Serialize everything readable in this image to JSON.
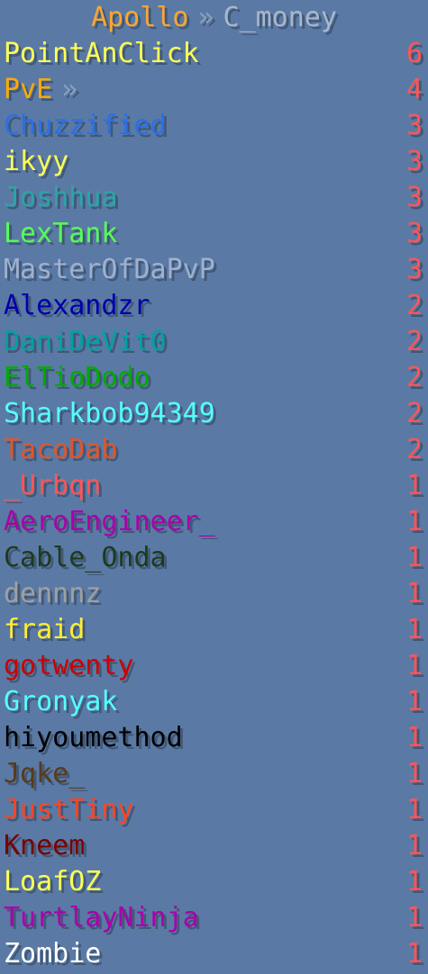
{
  "scoreboard": {
    "header": {
      "server": "Apollo",
      "separator": "»",
      "objective": "C_money"
    },
    "colors": {
      "background": "#5a7aa5",
      "header_server": "#ffa62e",
      "header_separator": "#8aa0c0",
      "header_objective": "#a9b7cc",
      "score": "#ff5555"
    },
    "entries": [
      {
        "name": "PointAnClick",
        "suffix": "",
        "score": "6",
        "color": "#ffff55"
      },
      {
        "name": "PvE",
        "suffix": "»",
        "score": "4",
        "color": "#ffaa00"
      },
      {
        "name": "Chuzzified",
        "suffix": "",
        "score": "3",
        "color": "#2c6fe6"
      },
      {
        "name": "ikyy",
        "suffix": "",
        "score": "3",
        "color": "#ffff55"
      },
      {
        "name": "Joshhua",
        "suffix": "",
        "score": "3",
        "color": "#2aa5a5"
      },
      {
        "name": "LexTank",
        "suffix": "",
        "score": "3",
        "color": "#55ff55"
      },
      {
        "name": "MasterOfDaPvP",
        "suffix": "",
        "score": "3",
        "color": "#9fb1d0"
      },
      {
        "name": "Alexandzr",
        "suffix": "",
        "score": "2",
        "color": "#0000aa"
      },
      {
        "name": "DaniDeVit0",
        "suffix": "",
        "score": "2",
        "color": "#00a0a0"
      },
      {
        "name": "ElTioDodo",
        "suffix": "",
        "score": "2",
        "color": "#00aa00"
      },
      {
        "name": "Sharkbob94349",
        "suffix": "",
        "score": "2",
        "color": "#55ffff"
      },
      {
        "name": "TacoDab",
        "suffix": "",
        "score": "2",
        "color": "#e0552a"
      },
      {
        "name": "_Urbqn",
        "suffix": "",
        "score": "1",
        "color": "#ff5555"
      },
      {
        "name": "AeroEngineer_",
        "suffix": "",
        "score": "1",
        "color": "#aa00aa"
      },
      {
        "name": "Cable_Onda",
        "suffix": "",
        "score": "1",
        "color": "#1e3a1e"
      },
      {
        "name": "dennnz",
        "suffix": "",
        "score": "1",
        "color": "#a0a0a0"
      },
      {
        "name": "fraid",
        "suffix": "",
        "score": "1",
        "color": "#ffee33"
      },
      {
        "name": "gotwenty",
        "suffix": "",
        "score": "1",
        "color": "#cc0000"
      },
      {
        "name": "Gronyak",
        "suffix": "",
        "score": "1",
        "color": "#55ffff"
      },
      {
        "name": "hiyoumethod",
        "suffix": "",
        "score": "1",
        "color": "#000000"
      },
      {
        "name": "Jqke_",
        "suffix": "",
        "score": "1",
        "color": "#5a3a1a"
      },
      {
        "name": "JustTiny",
        "suffix": "",
        "score": "1",
        "color": "#ff4422"
      },
      {
        "name": "Kneem",
        "suffix": "",
        "score": "1",
        "color": "#7a0000"
      },
      {
        "name": "LoafOZ",
        "suffix": "",
        "score": "1",
        "color": "#ffff55"
      },
      {
        "name": "TurtlayNinja",
        "suffix": "",
        "score": "1",
        "color": "#aa00aa"
      },
      {
        "name": "Zombie",
        "suffix": "",
        "score": "1",
        "color": "#ffffff"
      }
    ]
  }
}
